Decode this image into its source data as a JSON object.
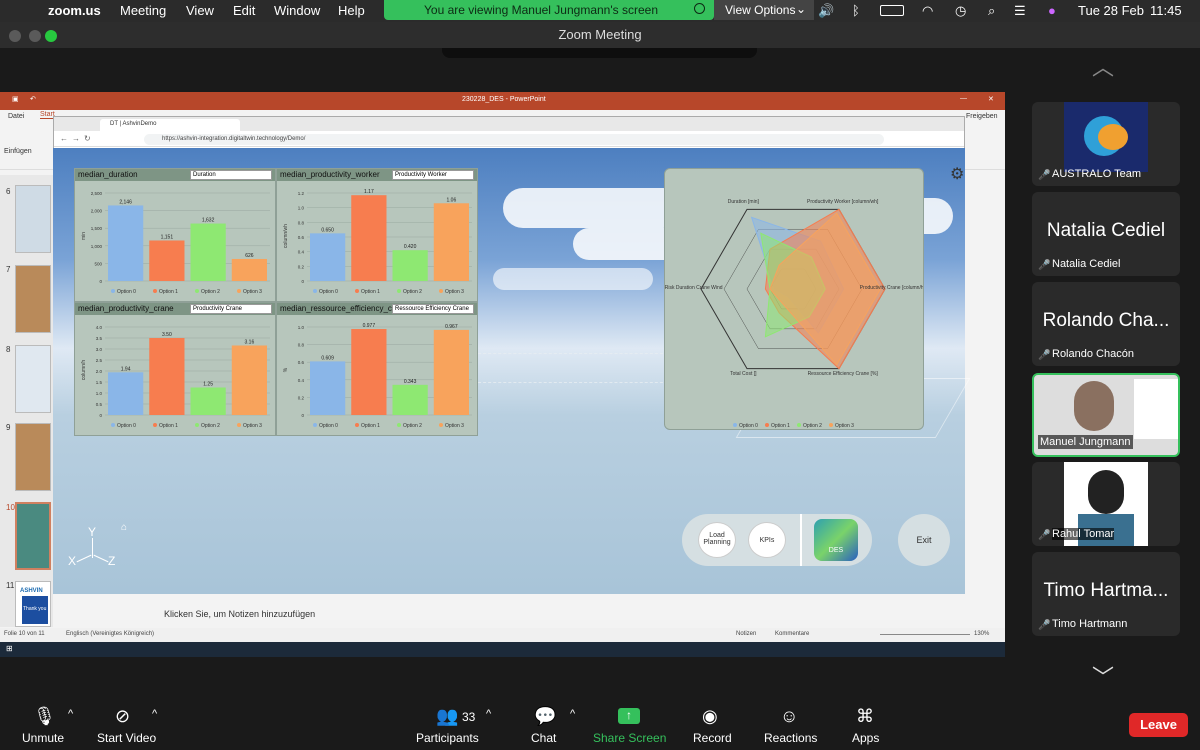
{
  "menubar": {
    "apple": "",
    "app": "zoom.us",
    "items": [
      "Meeting",
      "View",
      "Edit",
      "Window",
      "Help"
    ],
    "date": "Tue 28 Feb",
    "time": "11:45"
  },
  "banner": {
    "text": "You are viewing Manuel Jungmann's screen",
    "view_options": "View Options"
  },
  "window_title": "Zoom Meeting",
  "ppt": {
    "title": "230228_DES - PowerPoint",
    "tabs": [
      "Datei",
      "Start"
    ],
    "share": "Freigeben",
    "notes_placeholder": "Klicken Sie, um Notizen hinzuzufügen",
    "status_left": "Folie 10 von 11",
    "status_lang": "Englisch (Vereinigtes Königreich)",
    "notes_btn": "Notizen",
    "comments_btn": "Kommentare",
    "zoom": "130%",
    "slides": [
      "6",
      "7",
      "8",
      "9",
      "10",
      "11"
    ],
    "thankyou": "Thank you",
    "ashvin": "ASHVIN",
    "clipboard": "Einfügen"
  },
  "browser": {
    "tab": "DT | AshvinDemo",
    "url": "https://ashvin-integration.digitaltwin.technology/Demo/"
  },
  "charts": [
    {
      "title": "median_duration",
      "dropdown": "Duration",
      "ylabel": "min",
      "ymax": 2500,
      "ticks": [
        "0",
        "500",
        "1,000",
        "1,500",
        "2,000",
        "2,500"
      ],
      "values": [
        2146,
        1151,
        1632,
        626
      ],
      "labels": [
        "2,146",
        "1,151",
        "1,632",
        "626"
      ]
    },
    {
      "title": "median_productivity_worker",
      "dropdown": "Productivity Worker",
      "ylabel": "column/wh",
      "ymax": 1.2,
      "ticks": [
        "0",
        "0.2",
        "0.4",
        "0.6",
        "0.8",
        "1.0",
        "1.2"
      ],
      "values": [
        0.65,
        1.17,
        0.42,
        1.06
      ],
      "labels": [
        "0.650",
        "1.17",
        "0.420",
        "1.06"
      ]
    },
    {
      "title": "median_productivity_crane",
      "dropdown": "Productivity Crane",
      "ylabel": "column/h",
      "ymax": 4.0,
      "ticks": [
        "0",
        "0.5",
        "1.0",
        "1.5",
        "2.0",
        "2.5",
        "3.0",
        "3.5",
        "4.0"
      ],
      "values": [
        1.94,
        3.5,
        1.25,
        3.16
      ],
      "labels": [
        "1.94",
        "3.50",
        "1.25",
        "3.16"
      ]
    },
    {
      "title": "median_ressource_efficiency_crane",
      "dropdown": "Ressource Efficiency Crane",
      "ylabel": "%",
      "ymax": 1.0,
      "ticks": [
        "0",
        "0.2",
        "0.4",
        "0.6",
        "0.8",
        "1.0"
      ],
      "values": [
        0.609,
        0.977,
        0.343,
        0.967
      ],
      "labels": [
        "0.609",
        "0.977",
        "0.343",
        "0.967"
      ]
    }
  ],
  "legend": [
    "Option 0",
    "Option 1",
    "Option 2",
    "Option 3"
  ],
  "colors": {
    "opt0": "#8ab6e8",
    "opt1": "#f77d4f",
    "opt2": "#8ee872",
    "opt3": "#f8a35c",
    "green": "#35c05c",
    "leave": "#e02828"
  },
  "radar": {
    "axes": [
      "Duration [min]",
      "Productivity Worker [column/wh]",
      "Productivity Crane [column/h]",
      "Ressource Efficiency Crane [%]",
      "Total Cost []",
      "Risk Duration Crane Wind"
    ]
  },
  "controls": {
    "load": "Load Planning",
    "kpis": "KPIs",
    "des": "DES",
    "exit": "Exit"
  },
  "axes": {
    "x": "X",
    "y": "Y",
    "z": "Z"
  },
  "participants_panel": [
    {
      "name": "AUSTRALO Team",
      "big": "",
      "muted": true
    },
    {
      "name": "Natalia Cediel",
      "big": "Natalia Cediel",
      "muted": true
    },
    {
      "name": "Rolando Chacón",
      "big": "Rolando Cha...",
      "muted": true
    },
    {
      "name": "Manuel Jungmann",
      "big": "",
      "muted": false
    },
    {
      "name": "Rahul Tomar",
      "big": "",
      "muted": true
    },
    {
      "name": "Timo Hartmann",
      "big": "Timo Hartma...",
      "muted": true
    }
  ],
  "bottom": {
    "unmute": "Unmute",
    "start_video": "Start Video",
    "participants": "Participants",
    "participant_count": "33",
    "chat": "Chat",
    "share": "Share Screen",
    "record": "Record",
    "reactions": "Reactions",
    "apps": "Apps",
    "leave": "Leave"
  }
}
